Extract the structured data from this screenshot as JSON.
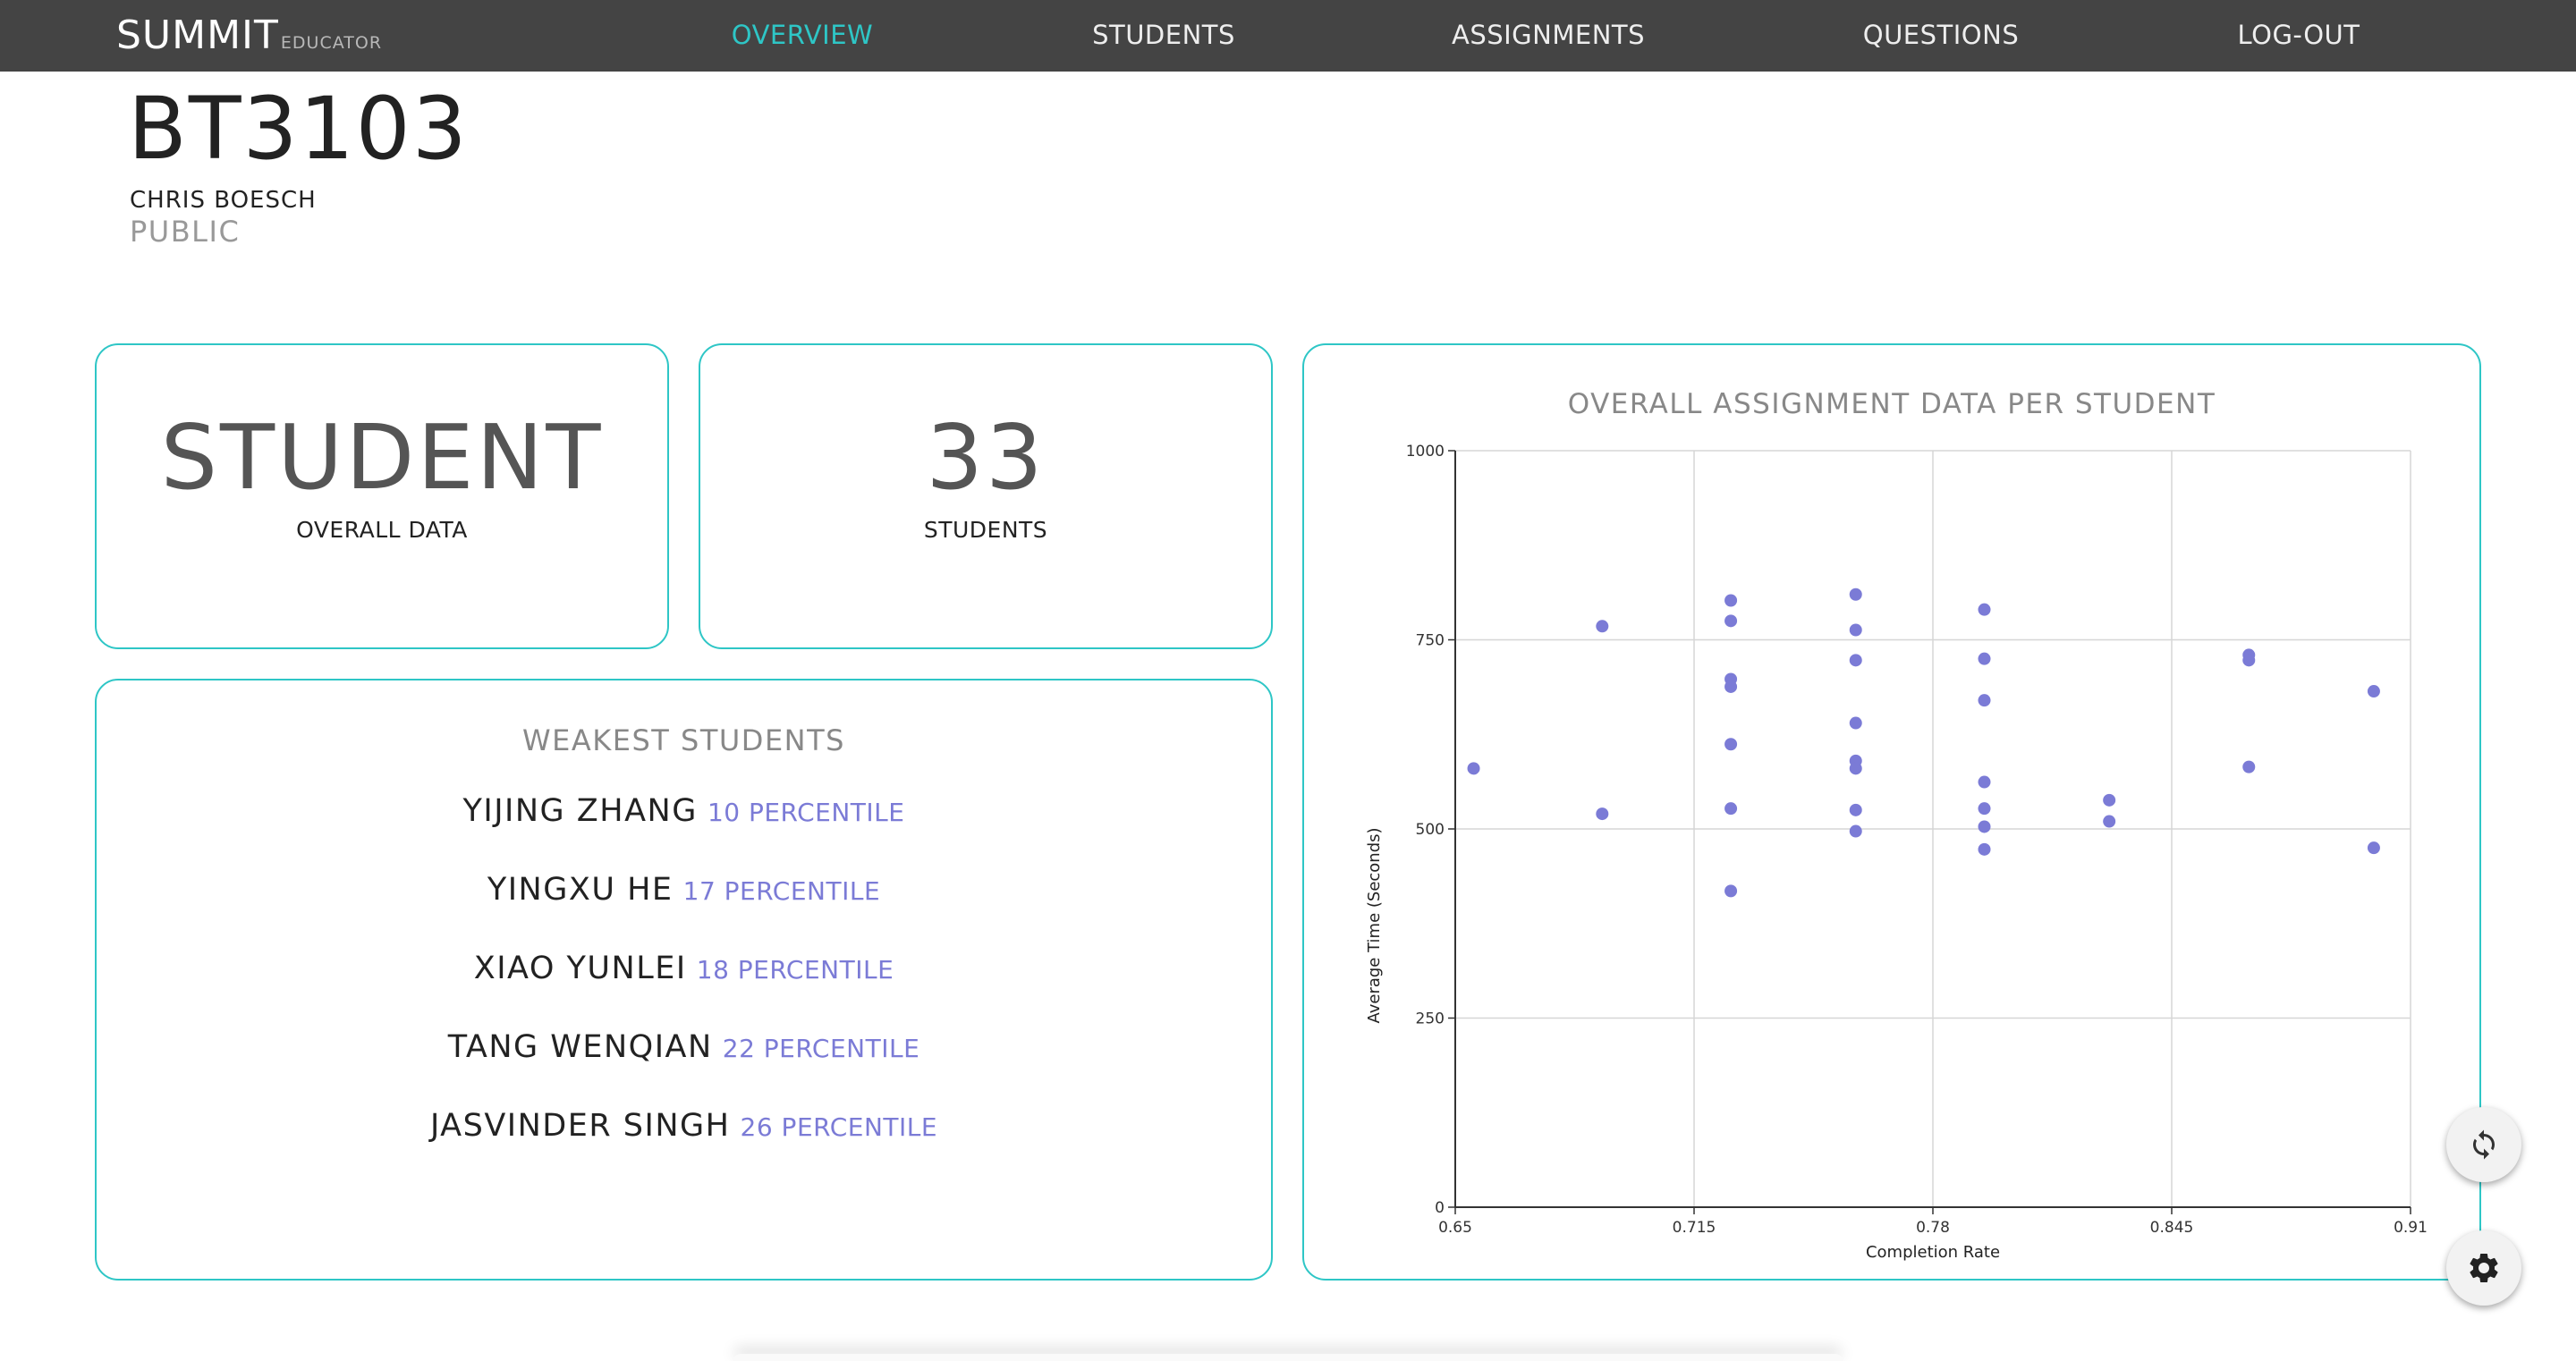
{
  "app": {
    "brand": "SUMMIT",
    "brand_sub": "EDUCATOR"
  },
  "nav": {
    "items": [
      {
        "label": "OVERVIEW",
        "active": true
      },
      {
        "label": "STUDENTS",
        "active": false
      },
      {
        "label": "ASSIGNMENTS",
        "active": false
      },
      {
        "label": "QUESTIONS",
        "active": false
      },
      {
        "label": "LOG-OUT",
        "active": false
      }
    ]
  },
  "course": {
    "code": "BT3103",
    "owner": "CHRIS BOESCH",
    "visibility": "PUBLIC"
  },
  "cards": {
    "student": {
      "big": "STUDENT",
      "small": "OVERALL DATA"
    },
    "count": {
      "big": "33",
      "small": "STUDENTS"
    }
  },
  "weakest": {
    "title": "WEAKEST STUDENTS",
    "students": [
      {
        "name": "YIJING ZHANG",
        "percentile": "10 PERCENTILE"
      },
      {
        "name": "YINGXU HE",
        "percentile": "17 PERCENTILE"
      },
      {
        "name": "XIAO YUNLEI",
        "percentile": "18 PERCENTILE"
      },
      {
        "name": "TANG WENQIAN",
        "percentile": "22 PERCENTILE"
      },
      {
        "name": "JASVINDER SINGH",
        "percentile": "26 PERCENTILE"
      }
    ]
  },
  "colors": {
    "accent": "#2ec6c6",
    "point": "#7b7bd6",
    "topbar": "#444444"
  },
  "chart_data": {
    "type": "scatter",
    "title": "OVERALL ASSIGNMENT DATA PER STUDENT",
    "xlabel": "Completion Rate",
    "ylabel": "Average Time (Seconds)",
    "xlim": [
      0.65,
      0.91
    ],
    "ylim": [
      0,
      1000
    ],
    "xticks": [
      "0.65",
      "0.715",
      "0.78",
      "0.845",
      "0.91"
    ],
    "yticks": [
      "0",
      "250",
      "500",
      "750",
      "1000"
    ],
    "grid": true,
    "points": [
      {
        "x": 0.655,
        "y": 580
      },
      {
        "x": 0.69,
        "y": 768
      },
      {
        "x": 0.69,
        "y": 520
      },
      {
        "x": 0.725,
        "y": 802
      },
      {
        "x": 0.725,
        "y": 775
      },
      {
        "x": 0.725,
        "y": 698
      },
      {
        "x": 0.725,
        "y": 688
      },
      {
        "x": 0.725,
        "y": 612
      },
      {
        "x": 0.725,
        "y": 527
      },
      {
        "x": 0.725,
        "y": 418
      },
      {
        "x": 0.759,
        "y": 810
      },
      {
        "x": 0.759,
        "y": 763
      },
      {
        "x": 0.759,
        "y": 723
      },
      {
        "x": 0.759,
        "y": 640
      },
      {
        "x": 0.759,
        "y": 590
      },
      {
        "x": 0.759,
        "y": 580
      },
      {
        "x": 0.759,
        "y": 525
      },
      {
        "x": 0.759,
        "y": 497
      },
      {
        "x": 0.794,
        "y": 790
      },
      {
        "x": 0.794,
        "y": 725
      },
      {
        "x": 0.794,
        "y": 670
      },
      {
        "x": 0.794,
        "y": 562
      },
      {
        "x": 0.794,
        "y": 527
      },
      {
        "x": 0.794,
        "y": 503
      },
      {
        "x": 0.794,
        "y": 473
      },
      {
        "x": 0.828,
        "y": 538
      },
      {
        "x": 0.828,
        "y": 510
      },
      {
        "x": 0.866,
        "y": 730
      },
      {
        "x": 0.866,
        "y": 723
      },
      {
        "x": 0.866,
        "y": 582
      },
      {
        "x": 0.9,
        "y": 682
      },
      {
        "x": 0.9,
        "y": 475
      }
    ]
  }
}
